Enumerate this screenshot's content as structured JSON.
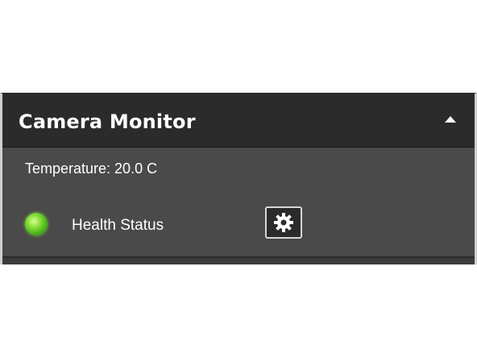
{
  "panel": {
    "title": "Camera Monitor",
    "collapse_icon": "chevron-up-icon",
    "temperature_text": "Temperature: 20.0 C",
    "health": {
      "label": "Health Status",
      "indicator_color": "#4fb81e",
      "icon": "status-led-icon"
    },
    "settings_icon": "gear-icon"
  },
  "colors": {
    "header_bg": "#2b2b2b",
    "body_bg": "#4a4a4a",
    "text": "#ffffff",
    "status_ok": "#4fb81e"
  }
}
